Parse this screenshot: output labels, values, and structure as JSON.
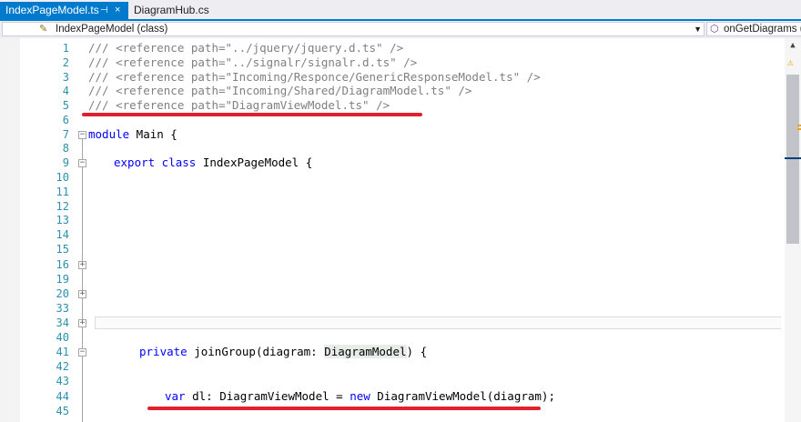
{
  "tabs": {
    "active": {
      "label": "IndexPageModel.ts",
      "pin": "⊣",
      "close": "×"
    },
    "inactive": {
      "label": "DiagramHub.cs"
    }
  },
  "navbar": {
    "class_combo": {
      "icon": "class-icon",
      "label": "IndexPageModel (class)"
    },
    "member_combo": {
      "icon": "method-icon",
      "label": "onGetDiagrams (n"
    }
  },
  "editor": {
    "line_numbers": [
      "1",
      "2",
      "3",
      "4",
      "5",
      "6",
      "7",
      "8",
      "9",
      "10",
      "11",
      "12",
      "13",
      "14",
      "15",
      "16",
      "19",
      "20",
      "33",
      "34",
      "40",
      "41",
      "42",
      "43",
      "44",
      "45"
    ],
    "lines": {
      "l1": "/// <reference path=\"../jquery/jquery.d.ts\" />",
      "l2": "/// <reference path=\"../signalr/signalr.d.ts\" />",
      "l3": "/// <reference path=\"Incoming/Responce/GenericResponseModel.ts\" />",
      "l4": "/// <reference path=\"Incoming/Shared/DiagramModel.ts\" />",
      "l5": "/// <reference path=\"DiagramViewModel.ts\" />",
      "l7_kw": "module",
      "l7_rest": " Main {",
      "l9_kw": "export class",
      "l9_rest": " IndexPageModel {",
      "l41_kw": "private",
      "l41_a": " joinGroup(diagram: ",
      "l41_type": "DiagramModel",
      "l41_b": ") {",
      "l44_kw1": "var",
      "l44_a": " dl: DiagramViewModel = ",
      "l44_kw2": "new",
      "l44_b": " DiagramViewModel(diagram);"
    }
  },
  "colors": {
    "accent": "#007acc",
    "comment": "#808080",
    "keyword": "#0000ff",
    "line_number": "#2b91af",
    "highlight_underline": "#e0202e"
  }
}
